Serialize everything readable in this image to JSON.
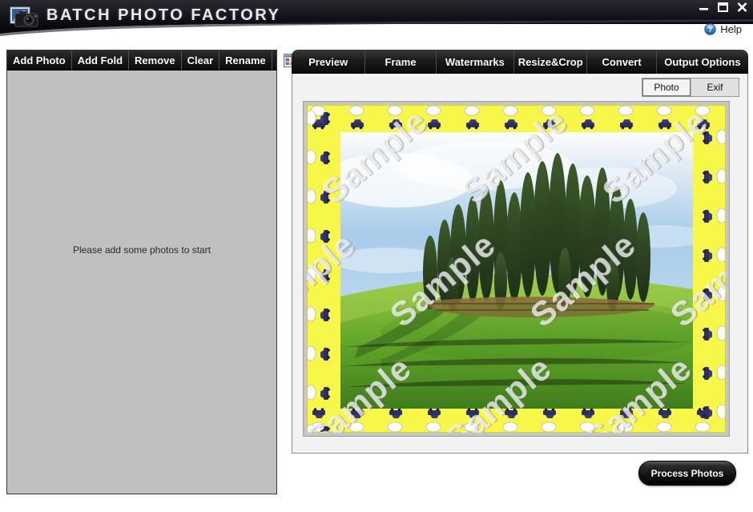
{
  "window": {
    "app_title": "BATCH PHOTO FACTORY",
    "logo_icon": "camera-photos-icon",
    "controls": [
      {
        "name": "minimize",
        "glyph": "minimize-icon"
      },
      {
        "name": "maximize",
        "glyph": "maximize-icon"
      },
      {
        "name": "close",
        "glyph": "close-icon"
      }
    ],
    "help_label": "Help",
    "help_icon": "question-circle-icon"
  },
  "left_panel": {
    "toolbar": {
      "buttons": [
        {
          "label": "Add Photo"
        },
        {
          "label": "Add Fold"
        },
        {
          "label": "Remove"
        },
        {
          "label": "Clear"
        },
        {
          "label": "Rename"
        }
      ],
      "view_icon": "thumbnail-grid-icon"
    },
    "empty_message": "Please add some photos to start"
  },
  "right_panel": {
    "tabs": [
      {
        "label": "Preview",
        "selected": true
      },
      {
        "label": "Frame",
        "selected": false
      },
      {
        "label": "Watermarks",
        "selected": false
      },
      {
        "label": "Resize&Crop",
        "selected": false
      },
      {
        "label": "Convert",
        "selected": false
      },
      {
        "label": "Output Options",
        "selected": false
      }
    ],
    "subtabs": [
      {
        "label": "Photo",
        "selected": true
      },
      {
        "label": "Exif",
        "selected": false
      }
    ],
    "preview": {
      "frame_color": "#f7f74a",
      "frame_style": "yellow-car-dots-border",
      "watermark_text": "Sample",
      "photo_description": "cypress trees on green hill under blue sky"
    }
  },
  "actions": {
    "process_label": "Process Photos"
  },
  "colors": {
    "header_dark": "#0d0d13",
    "toolbar_dark": "#191919",
    "panel_gray": "#c0c0c0",
    "content_bg": "#f2f2f2",
    "frame_yellow": "#f7f74a",
    "accent_blue": "#3b7fd4"
  }
}
